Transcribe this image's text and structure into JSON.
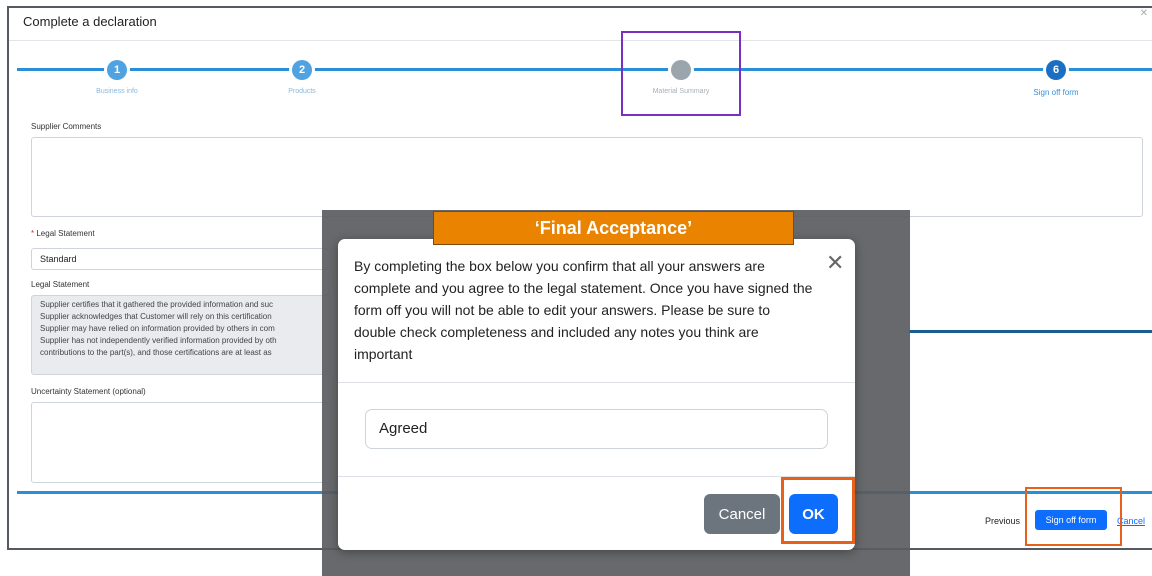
{
  "window": {
    "title": "Complete a declaration",
    "close_icon": "close-icon"
  },
  "stepper": {
    "accent_color": "#2a8fd6",
    "steps": [
      {
        "number": "1",
        "label": "Business info"
      },
      {
        "number": "2",
        "label": "Products"
      },
      {
        "number": "",
        "label": "Material Summary"
      },
      {
        "number": "6",
        "label": "Sign off form"
      }
    ]
  },
  "form": {
    "supplier_comments_label": "Supplier Comments",
    "required_marker": "*",
    "legal_statement_select_label": "Legal Statement",
    "legal_statement_value": "Standard",
    "legal_statement_text_label": "Legal Statement",
    "legal_statement_lines": [
      "Supplier certifies that it gathered the provided information and suc",
      "Supplier acknowledges that Customer will rely on this certification",
      "Supplier may have relied on information provided by others in com",
      "Supplier has not independently verified information provided by oth",
      "contributions to the part(s), and those certifications are at least as"
    ],
    "uncertainty_label": "Uncertainty Statement (optional)"
  },
  "footer": {
    "previous_label": "Previous",
    "sign_off_label": "Sign off form",
    "cancel_label": "Cancel"
  },
  "modal": {
    "message": "By completing the box below you confirm that all your answers are complete and you agree to the legal statement. Once you have signed the form off you will not be able to edit your answers. Please be sure to double check completeness and included any notes you think are important",
    "input_value": "Agreed",
    "cancel_label": "Cancel",
    "ok_label": "OK",
    "close_icon": "close-icon"
  },
  "annotation": {
    "banner_text": "‘Final Acceptance’",
    "banner_color": "#e98300",
    "highlight_color": "#e8611a",
    "step_highlight_color": "#7b2fbe"
  }
}
